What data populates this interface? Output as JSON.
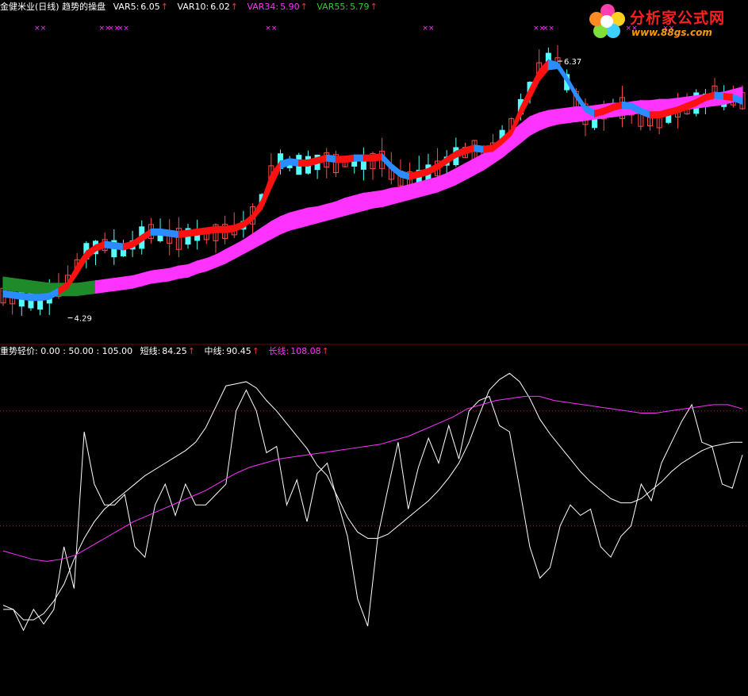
{
  "colors": {
    "background": "#000000",
    "white": "#ffffff",
    "yellow": "#ffff66",
    "magenta": "#ff33ff",
    "red": "#ff1111",
    "blue": "#2a8cff",
    "green": "#1f8a2a",
    "candle_up": "#ff4a4a",
    "candle_down": "#54ffff",
    "divider": "#7a0000",
    "dotted": "#aa2222"
  },
  "header_top": {
    "title": "金健米业(日线) 趋势的操盘",
    "var5_label": "VAR5:",
    "var5_value": "6.05",
    "var10_label": "VAR10:",
    "var10_value": "6.02",
    "var34_label": "VAR34:",
    "var34_value": "5.90",
    "var55_label": "VAR55:",
    "var55_value": "5.79",
    "arrow": "↑"
  },
  "header_bottom": {
    "name": "重势轻价",
    "levels": ": 0.00 : 50.00 : 105.00",
    "short_label": "短线:",
    "short_value": "84.25",
    "mid_label": "中线:",
    "mid_value": "90.45",
    "long_label": "长线:",
    "long_value": "108.08",
    "arrow": "↑"
  },
  "logo": {
    "title": "分析家公式网",
    "url": "www.88gs.com",
    "icon": "flower-logo-icon"
  },
  "chart_data": [
    {
      "type": "line",
      "panel": "price",
      "series": [
        {
          "name": "VAR5",
          "values": [
            4.47,
            4.46,
            4.45,
            4.44,
            4.43,
            4.45,
            4.5,
            4.58,
            4.72,
            4.83,
            4.86,
            4.88,
            4.85,
            4.83,
            4.88,
            4.94,
            4.99,
            4.96,
            4.94,
            4.93,
            4.95,
            4.96,
            4.97,
            4.98,
            4.99,
            5.0,
            5.04,
            5.12,
            5.25,
            5.46,
            5.56,
            5.54,
            5.53,
            5.53,
            5.55,
            5.57,
            5.54,
            5.55,
            5.56,
            5.55,
            5.56,
            5.57,
            5.47,
            5.42,
            5.41,
            5.43,
            5.46,
            5.5,
            5.56,
            5.6,
            5.63,
            5.64,
            5.62,
            5.66,
            5.73,
            5.82,
            6.0,
            6.15,
            6.3,
            6.38,
            6.36,
            6.2,
            6.05,
            5.94,
            5.91,
            5.94,
            5.98,
            5.99,
            5.98,
            5.93,
            5.91,
            5.91,
            5.94,
            5.97,
            6.0,
            6.03,
            6.07,
            6.09,
            6.06,
            6.06,
            6.05
          ]
        },
        {
          "name": "VAR10",
          "values": [
            4.46,
            4.45,
            4.44,
            4.43,
            4.43,
            4.44,
            4.48,
            4.53,
            4.64,
            4.76,
            4.83,
            4.86,
            4.85,
            4.84,
            4.86,
            4.91,
            4.96,
            4.96,
            4.95,
            4.94,
            4.95,
            4.96,
            4.97,
            4.98,
            4.98,
            4.99,
            5.02,
            5.08,
            5.17,
            5.34,
            5.5,
            5.53,
            5.52,
            5.52,
            5.54,
            5.56,
            5.55,
            5.55,
            5.56,
            5.56,
            5.56,
            5.57,
            5.49,
            5.43,
            5.41,
            5.43,
            5.45,
            5.49,
            5.54,
            5.59,
            5.62,
            5.64,
            5.63,
            5.64,
            5.7,
            5.77,
            5.92,
            6.06,
            6.21,
            6.3,
            6.31,
            6.2,
            6.07,
            5.96,
            5.92,
            5.94,
            5.97,
            5.99,
            5.98,
            5.94,
            5.91,
            5.91,
            5.93,
            5.95,
            5.98,
            6.01,
            6.05,
            6.07,
            6.06,
            6.05,
            6.02
          ]
        },
        {
          "name": "VAR34",
          "values": [
            4.52,
            4.51,
            4.5,
            4.49,
            4.48,
            4.47,
            4.47,
            4.47,
            4.48,
            4.5,
            4.52,
            4.54,
            4.56,
            4.57,
            4.59,
            4.61,
            4.63,
            4.65,
            4.66,
            4.68,
            4.7,
            4.73,
            4.76,
            4.8,
            4.84,
            4.88,
            4.92,
            4.97,
            5.02,
            5.07,
            5.11,
            5.14,
            5.16,
            5.18,
            5.19,
            5.21,
            5.23,
            5.26,
            5.28,
            5.3,
            5.31,
            5.32,
            5.34,
            5.35,
            5.37,
            5.39,
            5.41,
            5.43,
            5.46,
            5.5,
            5.54,
            5.58,
            5.62,
            5.67,
            5.73,
            5.8,
            5.86,
            5.92,
            5.95,
            5.97,
            5.98,
            5.99,
            6.0,
            6.0,
            6.01,
            6.02,
            6.03,
            6.03,
            6.04,
            6.05,
            6.05,
            6.06,
            6.06,
            6.07,
            6.08,
            6.09,
            6.1,
            6.11,
            6.12,
            6.14,
            6.15
          ]
        },
        {
          "name": "VAR55",
          "values": [
            4.52,
            4.51,
            4.5,
            4.49,
            4.48,
            4.47,
            4.47,
            4.47,
            4.47,
            4.48,
            4.49,
            4.5,
            4.51,
            4.52,
            4.53,
            4.55,
            4.57,
            4.58,
            4.59,
            4.61,
            4.62,
            4.65,
            4.67,
            4.7,
            4.73,
            4.77,
            4.81,
            4.85,
            4.89,
            4.93,
            4.97,
            5.0,
            5.02,
            5.04,
            5.06,
            5.08,
            5.1,
            5.12,
            5.14,
            5.16,
            5.18,
            5.19,
            5.21,
            5.23,
            5.25,
            5.27,
            5.29,
            5.31,
            5.34,
            5.37,
            5.41,
            5.45,
            5.49,
            5.54,
            5.59,
            5.65,
            5.71,
            5.77,
            5.81,
            5.84,
            5.86,
            5.87,
            5.88,
            5.89,
            5.9,
            5.91,
            5.92,
            5.93,
            5.94,
            5.95,
            5.95,
            5.96,
            5.96,
            5.97,
            5.98,
            5.99,
            6.0,
            6.01,
            6.02,
            6.04,
            6.06
          ]
        }
      ],
      "annotations": [
        {
          "label": "6.37",
          "value": 6.37,
          "index": 60
        },
        {
          "label": "4.29",
          "value": 4.29,
          "index": 7
        }
      ],
      "marker": "××",
      "marker_indices": [
        4,
        11,
        12,
        13,
        29,
        46,
        58,
        59,
        68,
        72
      ],
      "ylim": [
        4.1,
        6.75
      ],
      "grid": false
    },
    {
      "type": "line",
      "panel": "indicator",
      "series": [
        {
          "name": "短线",
          "values": [
            10,
            10,
            0,
            10,
            3,
            10,
            40,
            20,
            95,
            70,
            60,
            60,
            65,
            40,
            35,
            60,
            70,
            55,
            70,
            60,
            60,
            65,
            70,
            105,
            115,
            105,
            85,
            88,
            60,
            72,
            52,
            75,
            80,
            62,
            45,
            15,
            2,
            45,
            68,
            90,
            58,
            78,
            92,
            80,
            98,
            82,
            105,
            110,
            112,
            98,
            95,
            68,
            40,
            25,
            30,
            50,
            60,
            55,
            58,
            40,
            35,
            45,
            50,
            70,
            62,
            80,
            90,
            100,
            108,
            90,
            88,
            70,
            68,
            84
          ]
        },
        {
          "name": "中线",
          "values": [
            12,
            10,
            5,
            5,
            8,
            14,
            22,
            34,
            44,
            52,
            58,
            62,
            66,
            70,
            74,
            77,
            80,
            83,
            86,
            90,
            97,
            107,
            117,
            118,
            119,
            116,
            110,
            105,
            99,
            93,
            87,
            79,
            74,
            64,
            54,
            47,
            44,
            44,
            46,
            50,
            54,
            58,
            62,
            67,
            73,
            80,
            90,
            103,
            115,
            120,
            123,
            119,
            111,
            101,
            94,
            88,
            82,
            76,
            71,
            67,
            63,
            61,
            61,
            63,
            67,
            71,
            76,
            80,
            83,
            86,
            88,
            89,
            90,
            90
          ]
        },
        {
          "name": "长线",
          "values": [
            38,
            36,
            34,
            33,
            34,
            36,
            40,
            44,
            48,
            52,
            55,
            58,
            61,
            64,
            67,
            71,
            75,
            78,
            80,
            82,
            83,
            84,
            85,
            86,
            87,
            88,
            89,
            91,
            93,
            96,
            99,
            102,
            106,
            108,
            110,
            111,
            112,
            112,
            110,
            109,
            108,
            107,
            106,
            105,
            104,
            104,
            105,
            106,
            107,
            108,
            108,
            106
          ]
        }
      ],
      "reference_levels": [
        0,
        50,
        105
      ],
      "ylim": [
        -25,
        130
      ],
      "grid": false
    }
  ]
}
